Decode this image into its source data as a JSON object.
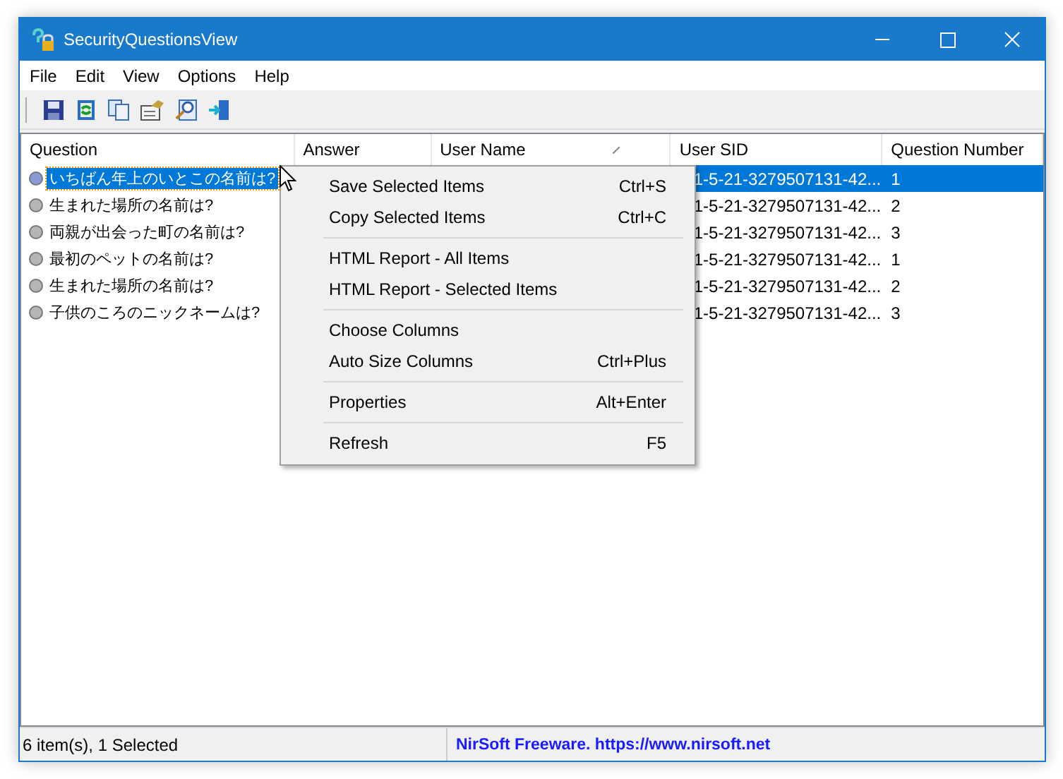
{
  "window": {
    "title": "SecurityQuestionsView"
  },
  "menu": [
    "File",
    "Edit",
    "View",
    "Options",
    "Help"
  ],
  "table": {
    "columns": [
      {
        "label": "Question",
        "sorted": false
      },
      {
        "label": "Answer",
        "sorted": false
      },
      {
        "label": "User Name",
        "sorted": true
      },
      {
        "label": "User SID",
        "sorted": false
      },
      {
        "label": "Question Number",
        "sorted": false
      }
    ],
    "rows": [
      {
        "question": "いちばん年上のいとこの名前は?",
        "user_sid": "1-5-21-3279507131-42...",
        "question_number": "1",
        "selected": true
      },
      {
        "question": "生まれた場所の名前は?",
        "user_sid": "1-5-21-3279507131-42...",
        "question_number": "2",
        "selected": false
      },
      {
        "question": "両親が出会った町の名前は?",
        "user_sid": "1-5-21-3279507131-42...",
        "question_number": "3",
        "selected": false
      },
      {
        "question": "最初のペットの名前は?",
        "user_sid": "1-5-21-3279507131-42...",
        "question_number": "1",
        "selected": false
      },
      {
        "question": "生まれた場所の名前は?",
        "user_sid": "1-5-21-3279507131-42...",
        "question_number": "2",
        "selected": false
      },
      {
        "question": "子供のころのニックネームは?",
        "user_sid": "1-5-21-3279507131-42...",
        "question_number": "3",
        "selected": false
      }
    ]
  },
  "context_menu": [
    {
      "kind": "item",
      "label": "Save Selected Items",
      "shortcut": "Ctrl+S"
    },
    {
      "kind": "item",
      "label": "Copy Selected Items",
      "shortcut": "Ctrl+C"
    },
    {
      "kind": "separator"
    },
    {
      "kind": "item",
      "label": "HTML Report - All Items"
    },
    {
      "kind": "item",
      "label": "HTML Report - Selected Items"
    },
    {
      "kind": "separator"
    },
    {
      "kind": "item",
      "label": "Choose Columns"
    },
    {
      "kind": "item",
      "label": "Auto Size Columns",
      "shortcut": "Ctrl+Plus"
    },
    {
      "kind": "separator"
    },
    {
      "kind": "item",
      "label": "Properties",
      "shortcut": "Alt+Enter"
    },
    {
      "kind": "separator"
    },
    {
      "kind": "item",
      "label": "Refresh",
      "shortcut": "F5"
    }
  ],
  "status_bar": {
    "count": "6 item(s), 1 Selected",
    "link": "NirSoft Freeware. https://www.nirsoft.net"
  }
}
